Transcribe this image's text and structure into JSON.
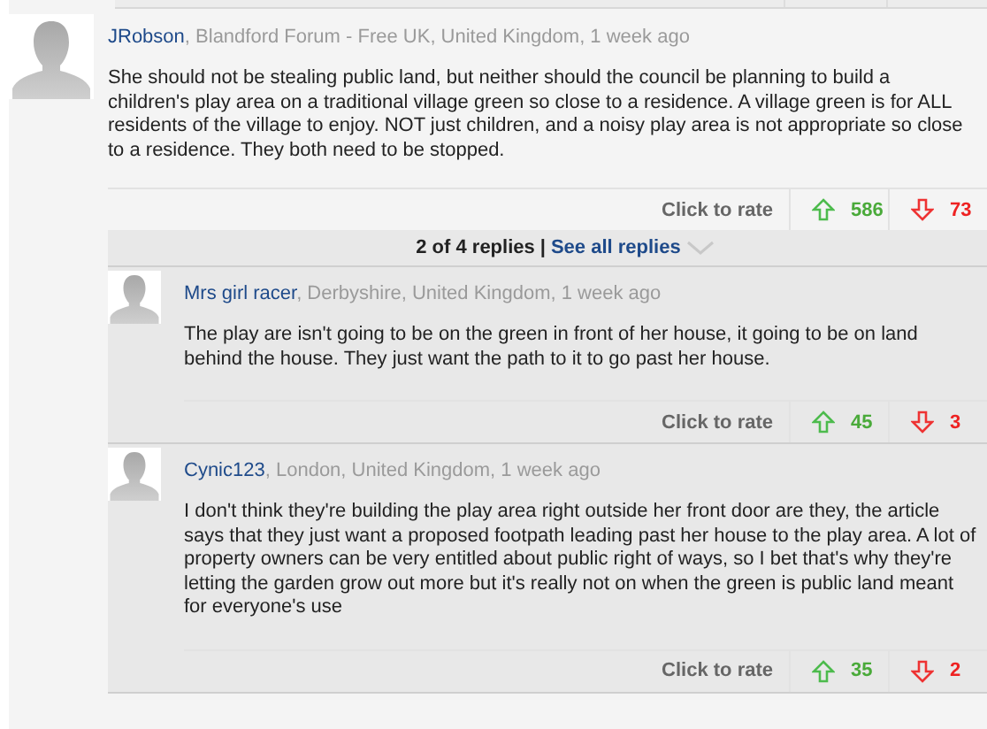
{
  "comment": {
    "author": "JRobson",
    "details": ", Blandford Forum - Free UK, United Kingdom, 1 week ago",
    "body": "She should not be stealing public land, but neither should the council be planning to build a children's play area on a traditional village green so close to a residence. A village green is for ALL residents of the village to enjoy. NOT just children, and a noisy play area is not appropriate so close to a residence. They both need to be stopped.",
    "rate_label": "Click to rate",
    "up": "586",
    "down": "73"
  },
  "replies_bar": {
    "count": "2 of 4 replies",
    "separator": "|",
    "link": "See all replies"
  },
  "replies": [
    {
      "author": "Mrs girl racer",
      "details": ", Derbyshire, United Kingdom, 1 week ago",
      "body": "The play are isn't going to be on the green in front of her house, it going to be on land behind the house. They just want the path to it to go past her house.",
      "rate_label": "Click to rate",
      "up": "45",
      "down": "3"
    },
    {
      "author": "Cynic123",
      "details": ", London, United Kingdom, 1 week ago",
      "body": "I don't think they're building the play area right outside her front door are they, the article says that they just want a proposed footpath leading past her house to the play area. A lot of property owners can be very entitled about public right of ways, so I bet that's why they're letting the garden grow out more but it's really not on when the green is public land meant for everyone's use",
      "rate_label": "Click to rate",
      "up": "35",
      "down": "2"
    }
  ]
}
